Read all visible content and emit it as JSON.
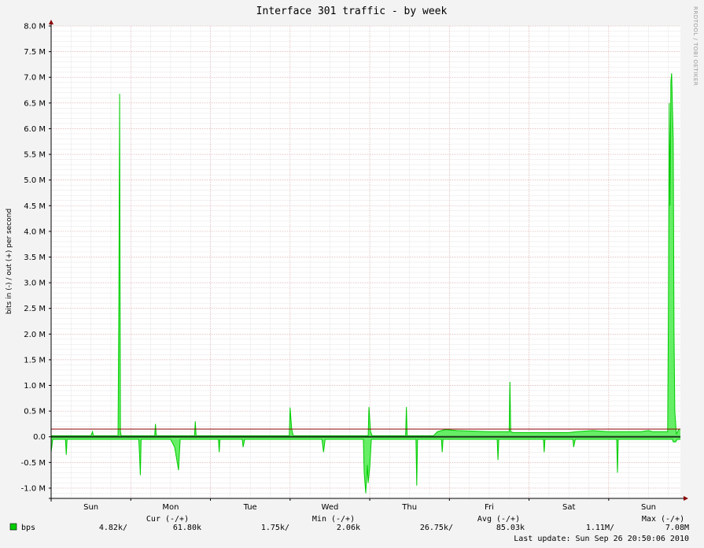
{
  "chart_data": {
    "type": "area",
    "title": "Interface 301 traffic - by week",
    "ylabel": "bits in (-) / out (+) per second",
    "watermark": "RRDTOOL / TOBI OETIKER",
    "ylim": [
      -1.2,
      8.0
    ],
    "y_ticks": [
      {
        "value": 8.0,
        "label": "8.0 M"
      },
      {
        "value": 7.5,
        "label": "7.5 M"
      },
      {
        "value": 7.0,
        "label": "7.0 M"
      },
      {
        "value": 6.5,
        "label": "6.5 M"
      },
      {
        "value": 6.0,
        "label": "6.0 M"
      },
      {
        "value": 5.5,
        "label": "5.5 M"
      },
      {
        "value": 5.0,
        "label": "5.0 M"
      },
      {
        "value": 4.5,
        "label": "4.5 M"
      },
      {
        "value": 4.0,
        "label": "4.0 M"
      },
      {
        "value": 3.5,
        "label": "3.5 M"
      },
      {
        "value": 3.0,
        "label": "3.0 M"
      },
      {
        "value": 2.5,
        "label": "2.5 M"
      },
      {
        "value": 2.0,
        "label": "2.0 M"
      },
      {
        "value": 1.5,
        "label": "1.5 M"
      },
      {
        "value": 1.0,
        "label": "1.0 M"
      },
      {
        "value": 0.5,
        "label": "0.5 M"
      },
      {
        "value": 0.0,
        "label": "0.0"
      },
      {
        "value": -0.5,
        "label": "-0.5 M"
      },
      {
        "value": -1.0,
        "label": "-1.0 M"
      }
    ],
    "xlim": [
      0,
      7.9
    ],
    "x_ticks": [
      {
        "value": 0.5,
        "label": "Sun"
      },
      {
        "value": 1.5,
        "label": "Mon"
      },
      {
        "value": 2.5,
        "label": "Tue"
      },
      {
        "value": 3.5,
        "label": "Wed"
      },
      {
        "value": 4.5,
        "label": "Thu"
      },
      {
        "value": 5.5,
        "label": "Fri"
      },
      {
        "value": 6.5,
        "label": "Sat"
      },
      {
        "value": 7.5,
        "label": "Sun"
      }
    ],
    "day_boundaries": [
      1.0,
      2.0,
      3.0,
      4.0,
      5.0,
      6.0,
      7.0
    ],
    "grid": true,
    "hrule": {
      "value": 0.15,
      "color": "#8b0000"
    },
    "series": [
      {
        "name": "bps",
        "color": "#00cc00",
        "fill": "#66ee66",
        "out_points": [
          [
            0.0,
            0.02
          ],
          [
            0.5,
            0.02
          ],
          [
            0.52,
            0.1
          ],
          [
            0.53,
            0.02
          ],
          [
            0.84,
            0.02
          ],
          [
            0.85,
            2.58
          ],
          [
            0.86,
            6.68
          ],
          [
            0.87,
            0.1
          ],
          [
            0.88,
            0.02
          ],
          [
            1.3,
            0.02
          ],
          [
            1.31,
            0.25
          ],
          [
            1.32,
            0.02
          ],
          [
            1.8,
            0.02
          ],
          [
            1.81,
            0.3
          ],
          [
            1.82,
            0.02
          ],
          [
            2.0,
            0.02
          ],
          [
            2.99,
            0.02
          ],
          [
            3.0,
            0.57
          ],
          [
            3.02,
            0.15
          ],
          [
            3.04,
            0.02
          ],
          [
            3.98,
            0.02
          ],
          [
            3.99,
            0.58
          ],
          [
            4.01,
            0.1
          ],
          [
            4.03,
            0.02
          ],
          [
            4.45,
            0.02
          ],
          [
            4.46,
            0.58
          ],
          [
            4.47,
            0.02
          ],
          [
            4.8,
            0.02
          ],
          [
            4.85,
            0.1
          ],
          [
            4.9,
            0.12
          ],
          [
            4.95,
            0.14
          ],
          [
            5.1,
            0.12
          ],
          [
            5.5,
            0.1
          ],
          [
            5.75,
            0.1
          ],
          [
            5.76,
            1.07
          ],
          [
            5.77,
            0.1
          ],
          [
            5.8,
            0.08
          ],
          [
            6.5,
            0.08
          ],
          [
            6.6,
            0.1
          ],
          [
            6.8,
            0.12
          ],
          [
            7.0,
            0.1
          ],
          [
            7.4,
            0.1
          ],
          [
            7.5,
            0.12
          ],
          [
            7.55,
            0.1
          ],
          [
            7.74,
            0.1
          ],
          [
            7.75,
            2.6
          ],
          [
            7.76,
            6.5
          ],
          [
            7.77,
            4.5
          ],
          [
            7.78,
            6.9
          ],
          [
            7.79,
            7.08
          ],
          [
            7.81,
            5.8
          ],
          [
            7.82,
            2.0
          ],
          [
            7.83,
            0.5
          ],
          [
            7.85,
            0.05
          ],
          [
            7.88,
            0.15
          ],
          [
            7.9,
            0.15
          ]
        ],
        "in_points": [
          [
            0.0,
            -0.3
          ],
          [
            0.02,
            -0.05
          ],
          [
            0.18,
            -0.05
          ],
          [
            0.19,
            -0.35
          ],
          [
            0.2,
            -0.05
          ],
          [
            1.1,
            -0.05
          ],
          [
            1.11,
            -0.35
          ],
          [
            1.12,
            -0.75
          ],
          [
            1.13,
            -0.05
          ],
          [
            1.5,
            -0.05
          ],
          [
            1.55,
            -0.2
          ],
          [
            1.6,
            -0.65
          ],
          [
            1.62,
            -0.05
          ],
          [
            2.1,
            -0.05
          ],
          [
            2.11,
            -0.3
          ],
          [
            2.12,
            -0.05
          ],
          [
            2.4,
            -0.05
          ],
          [
            2.41,
            -0.2
          ],
          [
            2.43,
            -0.05
          ],
          [
            3.4,
            -0.05
          ],
          [
            3.42,
            -0.3
          ],
          [
            3.44,
            -0.05
          ],
          [
            3.92,
            -0.05
          ],
          [
            3.93,
            -0.7
          ],
          [
            3.95,
            -1.1
          ],
          [
            3.97,
            -0.55
          ],
          [
            3.98,
            -0.9
          ],
          [
            4.0,
            -0.6
          ],
          [
            4.02,
            -0.05
          ],
          [
            4.58,
            -0.05
          ],
          [
            4.59,
            -0.95
          ],
          [
            4.6,
            -0.05
          ],
          [
            4.9,
            -0.05
          ],
          [
            4.91,
            -0.3
          ],
          [
            4.92,
            -0.05
          ],
          [
            5.6,
            -0.05
          ],
          [
            5.61,
            -0.45
          ],
          [
            5.62,
            -0.05
          ],
          [
            6.18,
            -0.05
          ],
          [
            6.19,
            -0.3
          ],
          [
            6.2,
            -0.05
          ],
          [
            6.55,
            -0.05
          ],
          [
            6.56,
            -0.2
          ],
          [
            6.58,
            -0.05
          ],
          [
            7.1,
            -0.05
          ],
          [
            7.11,
            -0.7
          ],
          [
            7.12,
            -0.05
          ],
          [
            7.8,
            -0.05
          ],
          [
            7.81,
            -0.1
          ],
          [
            7.84,
            -0.1
          ],
          [
            7.86,
            -0.05
          ],
          [
            7.9,
            -0.05
          ]
        ]
      }
    ]
  },
  "legend": {
    "series_name": "bps",
    "cur_header": "Cur (-/+)",
    "min_header": "Min (-/+)",
    "avg_header": "Avg (-/+)",
    "max_header": "Max (-/+)",
    "cur_in": "4.82k/",
    "cur_out": "61.80k",
    "min_in": "1.75k/",
    "min_out": "2.06k",
    "avg_in": "26.75k/",
    "avg_out": "85.03k",
    "max_in": "1.11M/",
    "max_out": "7.08M",
    "last_update": "Last update: Sun Sep 26 20:50:06 2010"
  }
}
